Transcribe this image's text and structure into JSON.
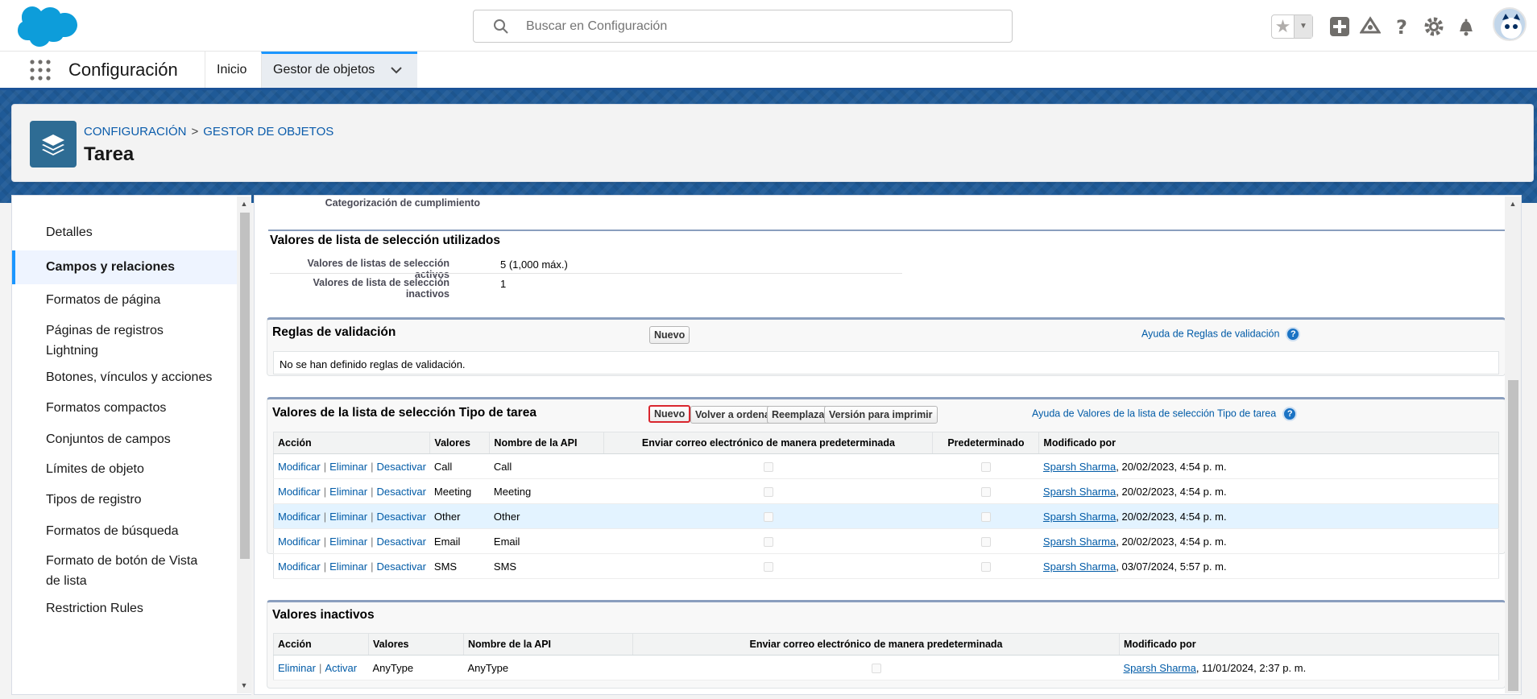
{
  "header": {
    "search_placeholder": "Buscar en Configuración",
    "icons": [
      "star-icon",
      "chevron-down-icon",
      "add-icon",
      "trailhead-icon",
      "help-icon",
      "gear-icon",
      "bell-icon",
      "avatar"
    ]
  },
  "nav": {
    "app_name": "Configuración",
    "tabs": [
      {
        "label": "Inicio"
      },
      {
        "label": "Gestor de objetos"
      }
    ]
  },
  "page": {
    "breadcrumb": [
      "CONFIGURACIÓN",
      "GESTOR DE OBJETOS"
    ],
    "breadcrumb_sep": ">",
    "title": "Tarea"
  },
  "sidebar": {
    "items": [
      {
        "label": "Detalles"
      },
      {
        "label": "Campos y relaciones"
      },
      {
        "label": "Formatos de página"
      },
      {
        "label": "Páginas de registros Lightning"
      },
      {
        "label": "Botones, vínculos y acciones"
      },
      {
        "label": "Formatos compactos"
      },
      {
        "label": "Conjuntos de campos"
      },
      {
        "label": "Límites de objeto"
      },
      {
        "label": "Tipos de registro"
      },
      {
        "label": "Formatos de búsqueda"
      },
      {
        "label": "Formato de botón de Vista de lista"
      },
      {
        "label": "Restriction Rules"
      }
    ],
    "active_index": 1
  },
  "top_fragment": {
    "label": "Categorización de cumplimiento"
  },
  "picklist_usage": {
    "title": "Valores de lista de selección utilizados",
    "rows": [
      {
        "label": "Valores de listas de selección activos",
        "value": "5 (1,000 máx.)"
      },
      {
        "label": "Valores de lista de selección inactivos",
        "value": "1"
      }
    ]
  },
  "validation": {
    "title": "Reglas de validación",
    "new_label": "Nuevo",
    "help_label": "Ayuda de Reglas de validación",
    "empty_text": "No se han definido reglas de validación."
  },
  "active_values": {
    "title": "Valores de la lista de selección Tipo de tarea",
    "buttons": {
      "new": "Nuevo",
      "reorder": "Volver a ordenar",
      "replace": "Reemplazar",
      "print": "Versión para imprimir"
    },
    "help_label": "Ayuda de Valores de la lista de selección Tipo de tarea",
    "columns": [
      "Acción",
      "Valores",
      "Nombre de la API",
      "Enviar correo electrónico de manera predeterminada",
      "Predeterminado",
      "Modificado por"
    ],
    "actions": {
      "edit": "Modificar",
      "delete": "Eliminar",
      "deactivate": "Desactivar",
      "sep": "|"
    },
    "rows": [
      {
        "value": "Call",
        "api": "Call",
        "user": "Sparsh Sharma",
        "date": ", 20/02/2023, 4:54 p. m."
      },
      {
        "value": "Meeting",
        "api": "Meeting",
        "user": "Sparsh Sharma",
        "date": ", 20/02/2023, 4:54 p. m."
      },
      {
        "value": "Other",
        "api": "Other",
        "user": "Sparsh Sharma",
        "date": ", 20/02/2023, 4:54 p. m."
      },
      {
        "value": "Email",
        "api": "Email",
        "user": "Sparsh Sharma",
        "date": ", 20/02/2023, 4:54 p. m."
      },
      {
        "value": "SMS",
        "api": "SMS",
        "user": "Sparsh Sharma",
        "date": ", 03/07/2024, 5:57 p. m."
      }
    ]
  },
  "inactive_values": {
    "title": "Valores inactivos",
    "columns": [
      "Acción",
      "Valores",
      "Nombre de la API",
      "Enviar correo electrónico de manera predeterminada",
      "Modificado por"
    ],
    "actions": {
      "delete": "Eliminar",
      "activate": "Activar",
      "sep": "|"
    },
    "rows": [
      {
        "value": "AnyType",
        "api": "AnyType",
        "user": "Sparsh Sharma",
        "date": ", 11/01/2024, 2:37 p. m."
      }
    ]
  },
  "colors": {
    "brand": "#0176d3",
    "link": "#015ba7",
    "highlight": "#d9262e",
    "band": "#1f5a97"
  }
}
